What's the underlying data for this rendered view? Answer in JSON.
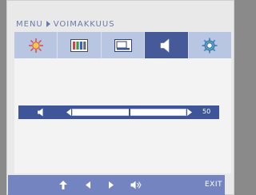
{
  "osd": {
    "breadcrumb": {
      "root": "MENU",
      "current": "VOIMAKKUUS"
    },
    "tabs": [
      {
        "icon": "brightness-sun-icon",
        "active": false
      },
      {
        "icon": "color-bars-icon",
        "active": false
      },
      {
        "icon": "display-screen-icon",
        "active": false
      },
      {
        "icon": "speaker-icon",
        "active": true
      },
      {
        "icon": "settings-gear-icon",
        "active": false
      }
    ],
    "volume": {
      "value": "50",
      "level_percent": 50
    },
    "bottom": {
      "exit_label": "EXIT"
    },
    "colors": {
      "tab_active": "#465a9a",
      "tabbar_bg": "#b9c6e2",
      "slider_bg": "#3f559a",
      "bottom_bar": "#7384c0",
      "title_text": "#6a7ba4"
    }
  }
}
